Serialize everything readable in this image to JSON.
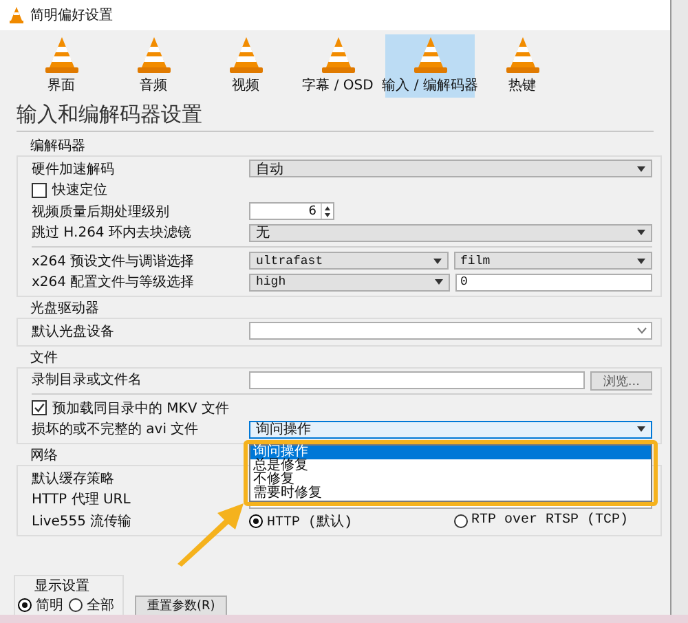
{
  "window": {
    "title": "简明偏好设置"
  },
  "tabs": [
    {
      "label": "界面",
      "selected": false
    },
    {
      "label": "音频",
      "selected": false
    },
    {
      "label": "视频",
      "selected": false
    },
    {
      "label": "字幕 / OSD",
      "selected": false
    },
    {
      "label": "输入 / 编解码器",
      "selected": true
    },
    {
      "label": "热键",
      "selected": false
    }
  ],
  "heading": "输入和编解码器设置",
  "sections": [
    {
      "title": "编解码器",
      "rows": [
        {
          "kind": "select",
          "label": "硬件加速解码",
          "value": "自动"
        },
        {
          "kind": "checkbox",
          "label": "快速定位",
          "checked": false
        },
        {
          "kind": "spin",
          "label": "视频质量后期处理级别",
          "value": "6"
        },
        {
          "kind": "select",
          "label": "跳过 H.264 环内去块滤镜",
          "value": "无"
        },
        {
          "kind": "separator"
        },
        {
          "kind": "select-pair",
          "label": "x264 预设文件与调谐选择",
          "value": "ultrafast",
          "value2": "film"
        },
        {
          "kind": "select-input",
          "label": "x264 配置文件与等级选择",
          "value": "high",
          "input": "0"
        }
      ]
    },
    {
      "title": "光盘驱动器",
      "rows": [
        {
          "kind": "combo",
          "label": "默认光盘设备"
        }
      ]
    },
    {
      "title": "文件",
      "rows": [
        {
          "kind": "browse",
          "label": "录制目录或文件名",
          "button": "浏览..."
        },
        {
          "kind": "separator"
        },
        {
          "kind": "checkbox",
          "label": "预加载同目录中的 MKV 文件",
          "checked": true
        },
        {
          "kind": "dropdown-open",
          "label": "损坏的或不完整的 avi 文件",
          "value": "询问操作",
          "options": [
            {
              "label": "询问操作",
              "selected": true
            },
            {
              "label": "总是修复",
              "selected": false
            },
            {
              "label": "不修复",
              "selected": false
            },
            {
              "label": "需要时修复",
              "selected": false
            }
          ]
        }
      ]
    },
    {
      "title": "网络",
      "rows": [
        {
          "kind": "covered",
          "label": "默认缓存策略"
        },
        {
          "kind": "text",
          "label": "HTTP 代理 URL"
        },
        {
          "kind": "radio",
          "label": "Live555 流传输",
          "options": [
            {
              "label": "HTTP (默认)",
              "selected": true
            },
            {
              "label": "RTP over RTSP (TCP)",
              "selected": false
            }
          ]
        }
      ]
    }
  ],
  "display_settings": {
    "title": "显示设置",
    "options": [
      {
        "label": "简明",
        "selected": true
      },
      {
        "label": "全部",
        "selected": false
      }
    ]
  },
  "reset_button": "重置参数(R)"
}
